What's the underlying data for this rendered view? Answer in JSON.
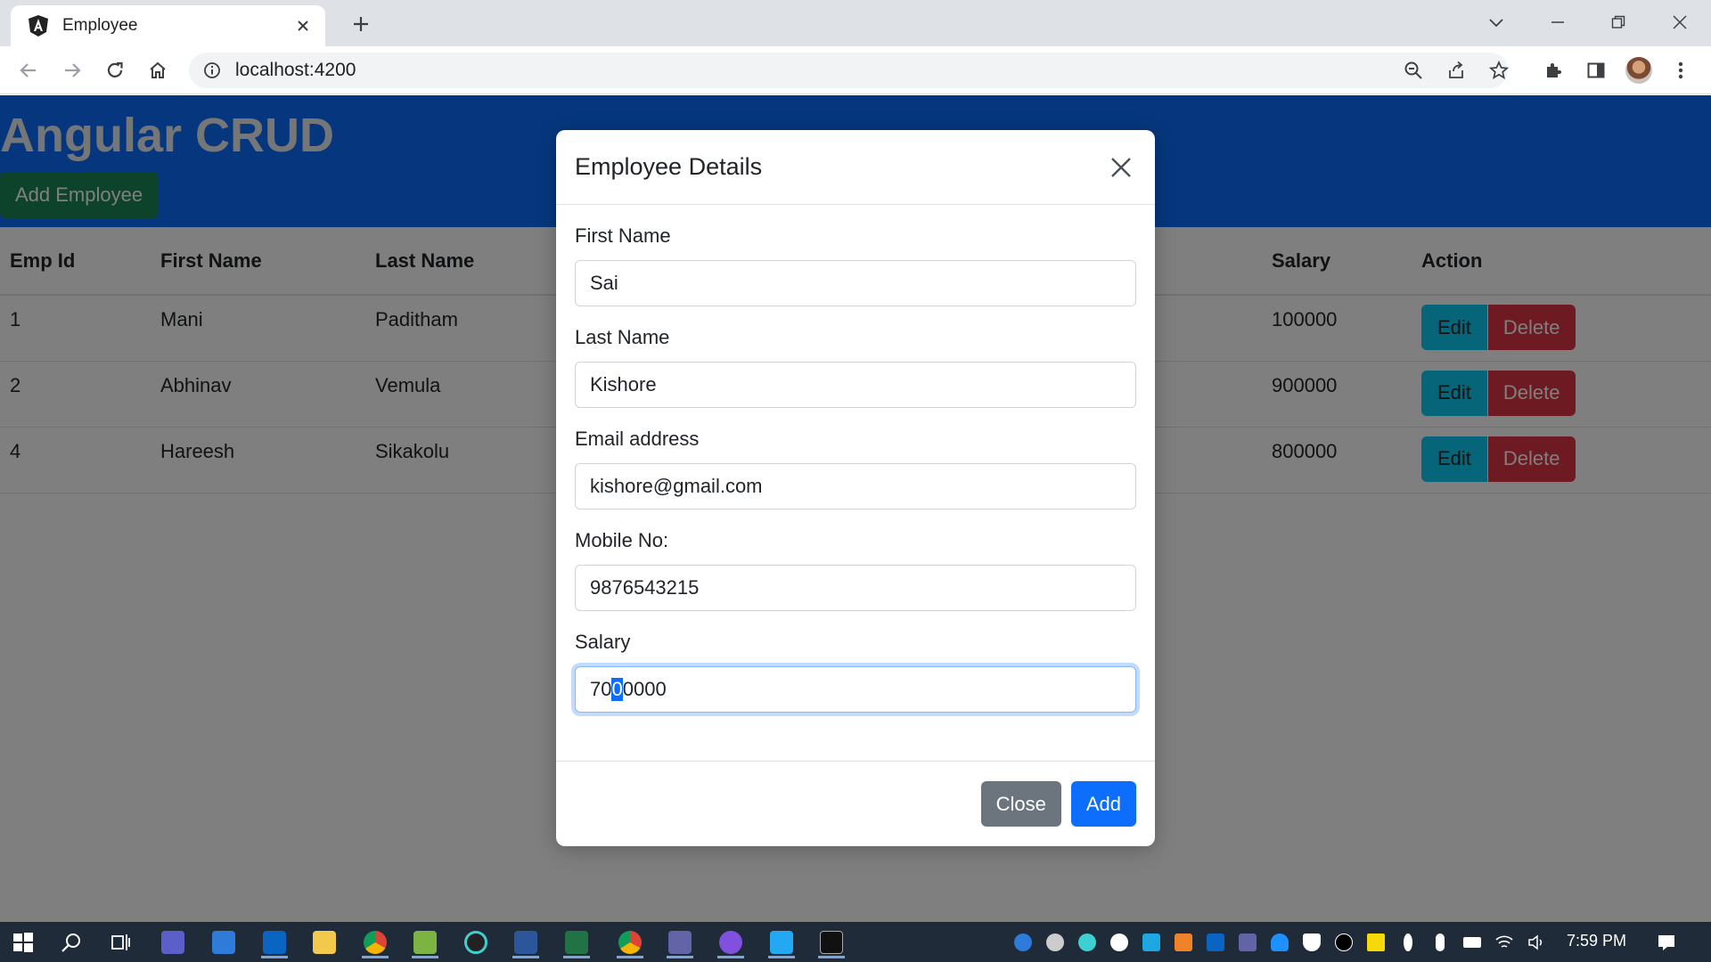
{
  "browser": {
    "tab_title": "Employee",
    "url": "localhost:4200"
  },
  "app": {
    "title": "Angular CRUD",
    "add_button": "Add Employee"
  },
  "table": {
    "headers": {
      "emp_id": "Emp Id",
      "first_name": "First Name",
      "last_name": "Last Name",
      "salary": "Salary",
      "action": "Action"
    },
    "rows": [
      {
        "emp_id": "1",
        "first_name": "Mani",
        "last_name": "Paditham",
        "salary": "100000"
      },
      {
        "emp_id": "2",
        "first_name": "Abhinav",
        "last_name": "Vemula",
        "salary": "900000"
      },
      {
        "emp_id": "4",
        "first_name": "Hareesh",
        "last_name": "Sikakolu",
        "salary": "800000"
      }
    ],
    "edit_label": "Edit",
    "delete_label": "Delete"
  },
  "modal": {
    "title": "Employee Details",
    "fields": {
      "first_name": {
        "label": "First Name",
        "value": "Sai"
      },
      "last_name": {
        "label": "Last Name",
        "value": "Kishore"
      },
      "email": {
        "label": "Email address",
        "value": "kishore@gmail.com"
      },
      "mobile": {
        "label": "Mobile No:",
        "value": "9876543215"
      },
      "salary": {
        "label": "Salary",
        "value": "7000000",
        "value_before": "70",
        "value_selected": "0",
        "value_after": "0000"
      }
    },
    "close_label": "Close",
    "add_label": "Add"
  },
  "taskbar": {
    "clock": "7:59 PM"
  },
  "colors": {
    "header_blue": "#0d6efd",
    "success_green": "#198754",
    "info_cyan": "#0dcaf0",
    "danger_red": "#dc3545",
    "secondary_gray": "#6c757d",
    "primary_blue": "#0d6efd",
    "taskbar": "#1f2b38"
  },
  "icons": [
    "angular-logo-icon",
    "close-icon",
    "plus-icon",
    "chevron-down-icon",
    "minimize-icon",
    "restore-icon",
    "back-icon",
    "forward-icon",
    "reload-icon",
    "home-icon",
    "info-icon",
    "zoom-out-icon",
    "share-icon",
    "star-icon",
    "extensions-icon",
    "side-panel-icon",
    "menu-icon"
  ]
}
